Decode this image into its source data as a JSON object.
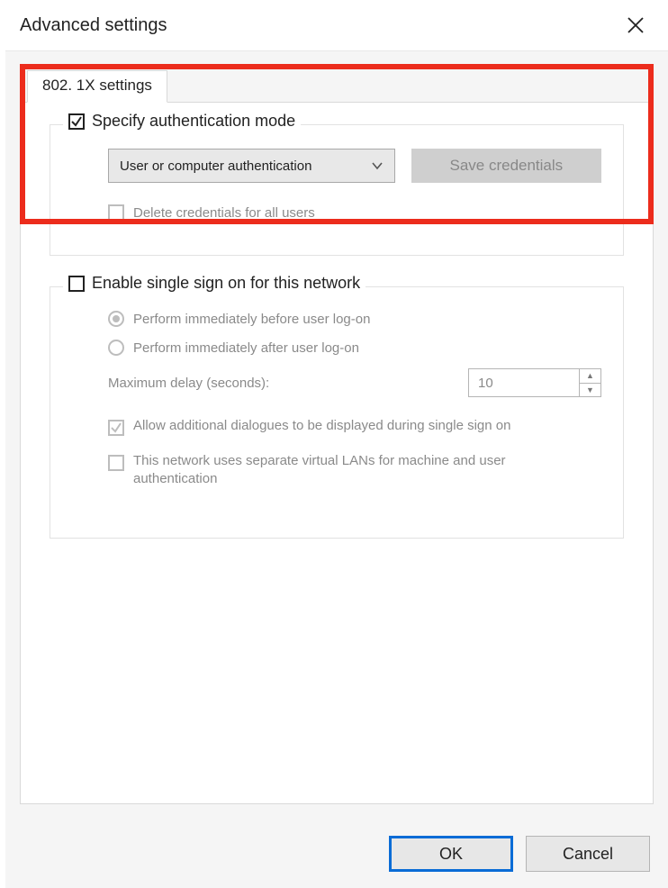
{
  "window_title": "Advanced settings",
  "tab": "802. 1X settings",
  "group1": {
    "legend": "Specify authentication mode",
    "legend_checked": true,
    "auth_mode": "User or computer authentication",
    "save_credentials": "Save credentials",
    "delete_credentials": "Delete credentials for all users"
  },
  "group2": {
    "legend": "Enable single sign on for this network",
    "radio_before": "Perform immediately before user log-on",
    "radio_after": "Perform immediately after user log-on",
    "max_delay_label": "Maximum delay (seconds):",
    "max_delay_value": "10",
    "allow_dialogues": "Allow additional dialogues to be displayed during single sign on",
    "separate_vlan": "This network uses separate virtual LANs for machine and user authentication"
  },
  "buttons": {
    "ok": "OK",
    "cancel": "Cancel"
  }
}
